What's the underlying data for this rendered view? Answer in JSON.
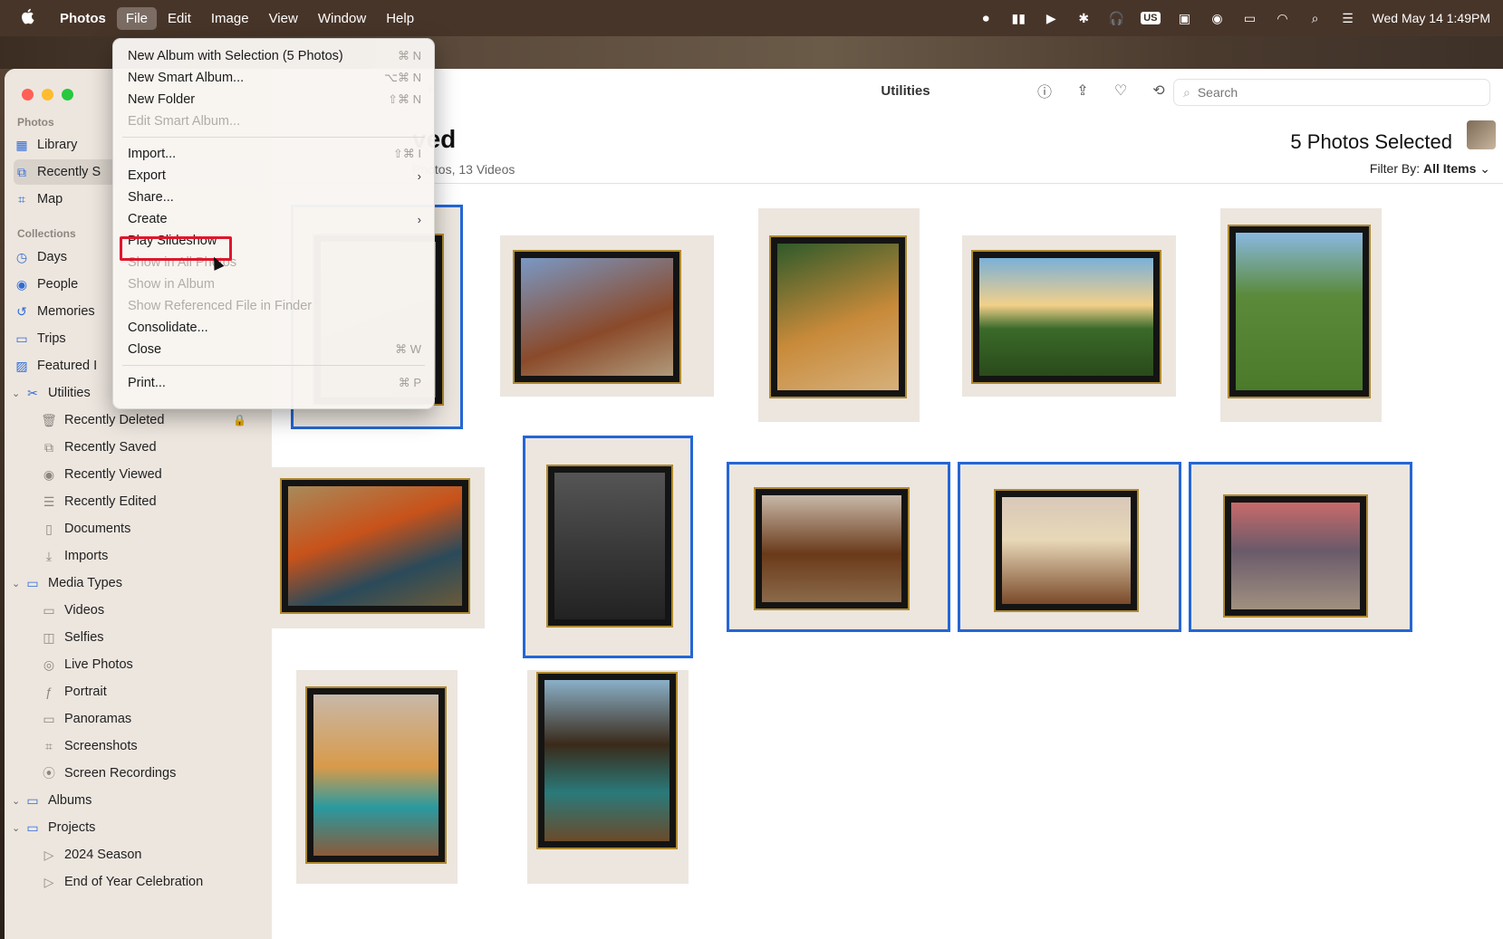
{
  "menubar": {
    "apple": "",
    "app": "Photos",
    "items": [
      "File",
      "Edit",
      "Image",
      "View",
      "Window",
      "Help"
    ],
    "input_source": "US",
    "clock": "Wed May 14  1:49PM"
  },
  "sidebar": {
    "section_photos": "Photos",
    "library": "Library",
    "recently_saved_top": "Recently S",
    "map": "Map",
    "section_collections": "Collections",
    "days": "Days",
    "people": "People",
    "memories": "Memories",
    "trips": "Trips",
    "featured": "Featured I",
    "utilities": "Utilities",
    "recently_deleted": "Recently Deleted",
    "recently_saved": "Recently Saved",
    "recently_viewed": "Recently Viewed",
    "recently_edited": "Recently Edited",
    "documents": "Documents",
    "imports": "Imports",
    "media_types": "Media Types",
    "videos": "Videos",
    "selfies": "Selfies",
    "live_photos": "Live Photos",
    "portrait": "Portrait",
    "panoramas": "Panoramas",
    "screenshots": "Screenshots",
    "screen_recordings": "Screen Recordings",
    "albums": "Albums",
    "projects": "Projects",
    "season_2024": "2024 Season",
    "end_of_year": "End of Year Celebration"
  },
  "toolbar": {
    "title": "Utilities",
    "search_placeholder": "Search",
    "plus": "+",
    "dash": "-"
  },
  "content": {
    "title": "ved",
    "subtitle": "Photos, 13 Videos",
    "selected_count": "5 Photos Selected",
    "filter_label": "Filter By:",
    "filter_value": "All Items"
  },
  "file_menu": {
    "new_album": "New Album with Selection (5 Photos)",
    "new_album_sc": "⌘ N",
    "new_smart_album": "New Smart Album...",
    "new_smart_album_sc": "⌥⌘ N",
    "new_folder": "New Folder",
    "new_folder_sc": "⇧⌘ N",
    "edit_smart_album": "Edit Smart Album...",
    "import": "Import...",
    "import_sc": "⇧⌘ I",
    "export": "Export",
    "share": "Share...",
    "create": "Create",
    "play_slideshow": "Play Slideshow",
    "show_in_all_photos": "Show in All Photos",
    "show_in_album": "Show in Album",
    "show_referenced": "Show Referenced File in Finder",
    "consolidate": "Consolidate...",
    "close": "Close",
    "close_sc": "⌘ W",
    "print": "Print...",
    "print_sc": "⌘ P"
  },
  "colors": {
    "selection": "#2466d6",
    "highlight_box": "#e0162b",
    "sidebar_icon": "#2f6bd8"
  }
}
